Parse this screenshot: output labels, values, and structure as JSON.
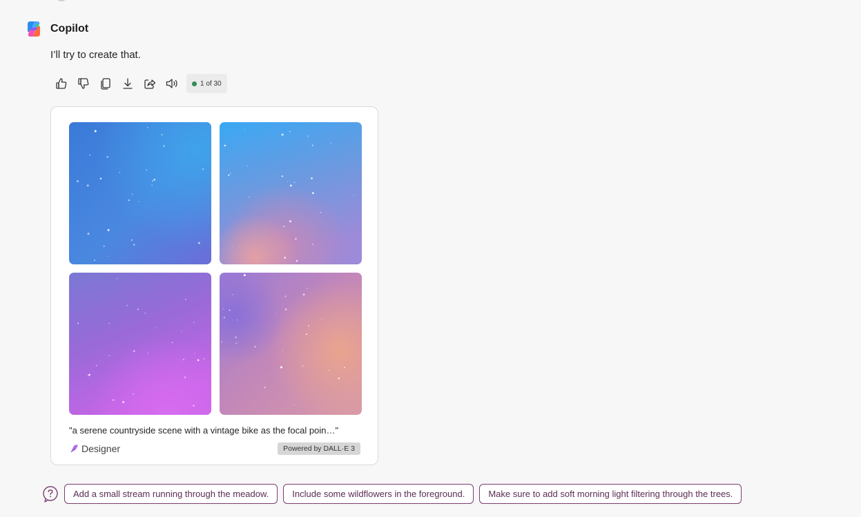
{
  "assistant": {
    "name": "Copilot",
    "icon": "copilot-logo-icon"
  },
  "message": {
    "text": "I’ll try to create that."
  },
  "actions": [
    {
      "id": "like",
      "icon": "thumbs-up-icon"
    },
    {
      "id": "dislike",
      "icon": "thumbs-down-icon"
    },
    {
      "id": "copy",
      "icon": "copy-icon"
    },
    {
      "id": "export",
      "icon": "download-icon"
    },
    {
      "id": "share",
      "icon": "share-icon"
    },
    {
      "id": "read-aloud",
      "icon": "speaker-icon"
    }
  ],
  "counter": {
    "text": "1 of 30",
    "dot_color": "#2e8b57"
  },
  "image_card": {
    "caption": "\"a serene countryside scene with a vintage bike as the focal poin…\"",
    "source": "Designer",
    "source_icon": "designer-icon",
    "badge": "Powered by DALL·E 3",
    "images": [
      {
        "name": "generated-image-1"
      },
      {
        "name": "generated-image-2"
      },
      {
        "name": "generated-image-3"
      },
      {
        "name": "generated-image-4"
      }
    ]
  },
  "suggestions": {
    "help_icon": "question-circle-icon",
    "items": [
      "Add a small stream running through the meadow.",
      "Include some wildflowers in the foreground.",
      "Make sure to add soft morning light filtering through the trees."
    ]
  },
  "colors": {
    "accent": "#7a3e72",
    "background": "#f7f7f7"
  }
}
